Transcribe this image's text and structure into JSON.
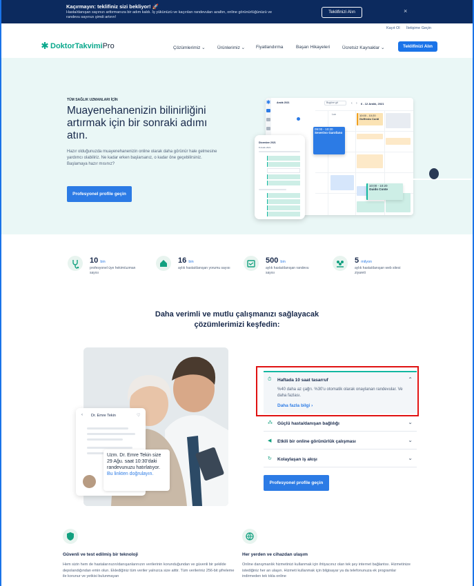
{
  "promo": {
    "title": "Kaçırmayın: teklifiniz sizi bekliyor! 🚀",
    "text": "Hasta/danışan sayınızı arttırmanıza bir adım kaldı. İş yükünüzü ve kaçırılan randevuları azaltın, online görünürlüğünüzü ve randevu sayınızı şimdi artırın!",
    "button": "Teklifinizi Alın",
    "close": "×"
  },
  "toplinks": {
    "login": "Kayıt Ol",
    "contact": "İletişime Geçin"
  },
  "nav": {
    "brand": "DoktorTakvimi",
    "brand_suffix": "Pro",
    "items": [
      "Çözümlerimiz ⌄",
      "Ürünlerimiz ⌄",
      "Fiyatlandırma",
      "Başarı Hikayeleri",
      "Ücretsiz Kaynaklar ⌄"
    ],
    "cta": "Teklifinizi Alın"
  },
  "hero": {
    "tag": "TÜM SAĞLIK UZMANLARI İÇİN",
    "title": "Muayenehanenizin bilinirliğini artırmak için bir sonraki adımı atın.",
    "description": "Hazır olduğunuzda muayenehanenizin online olarak daha görünür hale gelmesine yardımcı olabiliriz. Ne kadar erken başlarsanız, o kadar öne geçebilirsiniz.",
    "question": "Başlamaya hazır mısınız?",
    "button": "Profesyonel profile geçin"
  },
  "calendar": {
    "month": "Aralık 2021",
    "range": "6 - 12 Aralık, 2021",
    "today_btn": "Bugüne git",
    "weekday": "Lun",
    "events": [
      {
        "time": "10:00 - 10:20",
        "name": "Goffredo Conti",
        "color": "#fbe3b4"
      },
      {
        "time": "09:00 - 10:20",
        "name": "Severino Garofano",
        "color": "#2c7be5"
      },
      {
        "time": "10:00 - 10:20",
        "name": "Guido Conte",
        "color": "#cdeee6"
      }
    ],
    "phone_title": "Dicembre 2021",
    "phone_sub": "8 Aralık 2021"
  },
  "stats": [
    {
      "num": "10",
      "unit": "bin",
      "label": "profesyonel üye hekim/uzman sayısı"
    },
    {
      "num": "16",
      "unit": "bin",
      "label": "aylık hasta/danışan yorumu sayısı"
    },
    {
      "num": "500",
      "unit": "bin",
      "label": "aylık hasta/danışan randevu sayısı"
    },
    {
      "num": "5",
      "unit": "milyon",
      "label": "aylık hasta/danışan web sitesi ziyareti"
    }
  ],
  "solutions": {
    "title_line1": "Daha verimli ve mutlu çalışmanızı sağlayacak",
    "title_line2": "çözümlerimizi keşfedin:",
    "card_name": "Dr. Emre Tekin",
    "bubble_text": "Uzm. Dr. Emre Tekin size 29 Ağu. saat 10:30'daki randevunuzu hatırlatıyor.",
    "bubble_link": "Bu linkten doğrulayın.",
    "accordion": [
      {
        "title": "Haftada 10 saat tasarruf",
        "open": true,
        "body": "%40 daha az çağrı. %30'u otomatik olarak onaylanan randevular. Ve daha fazlası.",
        "link": "Daha fazla bilgi  ›"
      },
      {
        "title": "Güçlü hasta/danışan bağlılığı",
        "open": false
      },
      {
        "title": "Etkili bir online görünürlük çalışması",
        "open": false
      },
      {
        "title": "Kolaylaşan iş akışı",
        "open": false
      }
    ],
    "button": "Profesyonel profile geçin"
  },
  "features": [
    {
      "title": "Güvenli ve test edilmiş bir teknoloji",
      "text": "Hem sizin hem de hastalarınızın/danışanlarınızın verilerinin korunduğundan ve güvenli bir şekilde depolandığından emin olun. Eklediğiniz tüm veriler yalnızca size aittir. Tüm verileriniz 256-bit şifreleme ile korunur ve yetkisi bulunmayan"
    },
    {
      "title": "Her yerden ve cihazdan ulaşım",
      "text": "Online danışmanlık hizmetinizi kullanmak için ihtiyacınız olan tek şey internet bağlantısı. Hizmetinize istediğiniz her an ulaşın. Hizmeti kullanmak için bilgisayar ya da telefonunuza ek programlar indirmeden tek tıkla online"
    }
  ],
  "colors": {
    "accent": "#2c7be5",
    "brand": "#0aa88c",
    "promo_bg": "#0c2a5e",
    "hero_bg": "#eaf7f6",
    "highlight": "#e01010"
  }
}
